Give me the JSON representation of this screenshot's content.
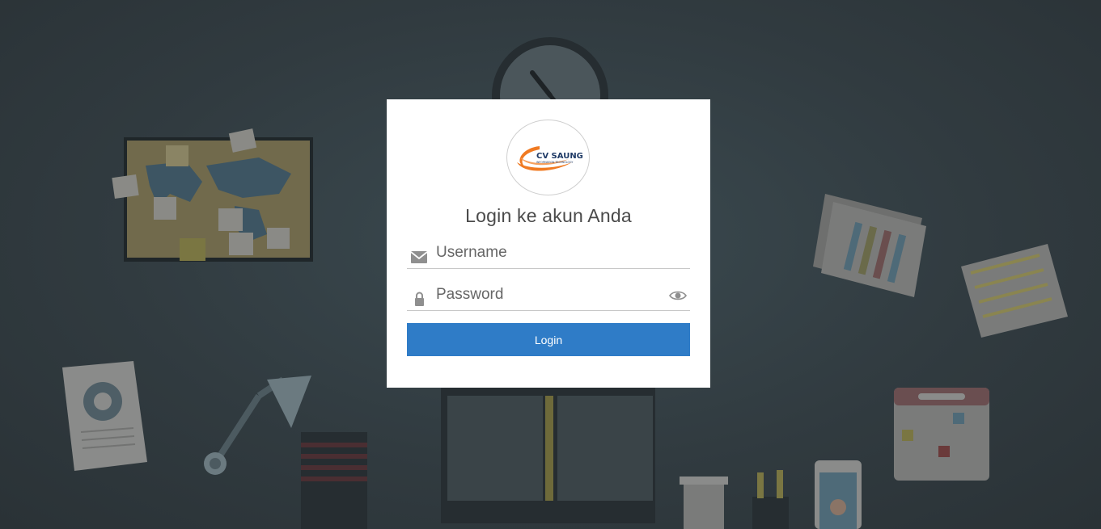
{
  "login": {
    "title": "Login ke akun Anda",
    "username_placeholder": "Username",
    "password_placeholder": "Password",
    "username_value": "",
    "password_value": "",
    "button_label": "Login"
  },
  "logo": {
    "brand_text": "CV SAUNG",
    "tagline_text": "INFORMATION TECHNOLOGY"
  },
  "icons": {
    "username": "envelope-icon",
    "password": "lock-icon",
    "show_password": "eye-icon"
  },
  "colors": {
    "button": "#2f7cc7",
    "background": "#313b40",
    "logo_accent": "#f07a22",
    "logo_text": "#1f3a66"
  }
}
